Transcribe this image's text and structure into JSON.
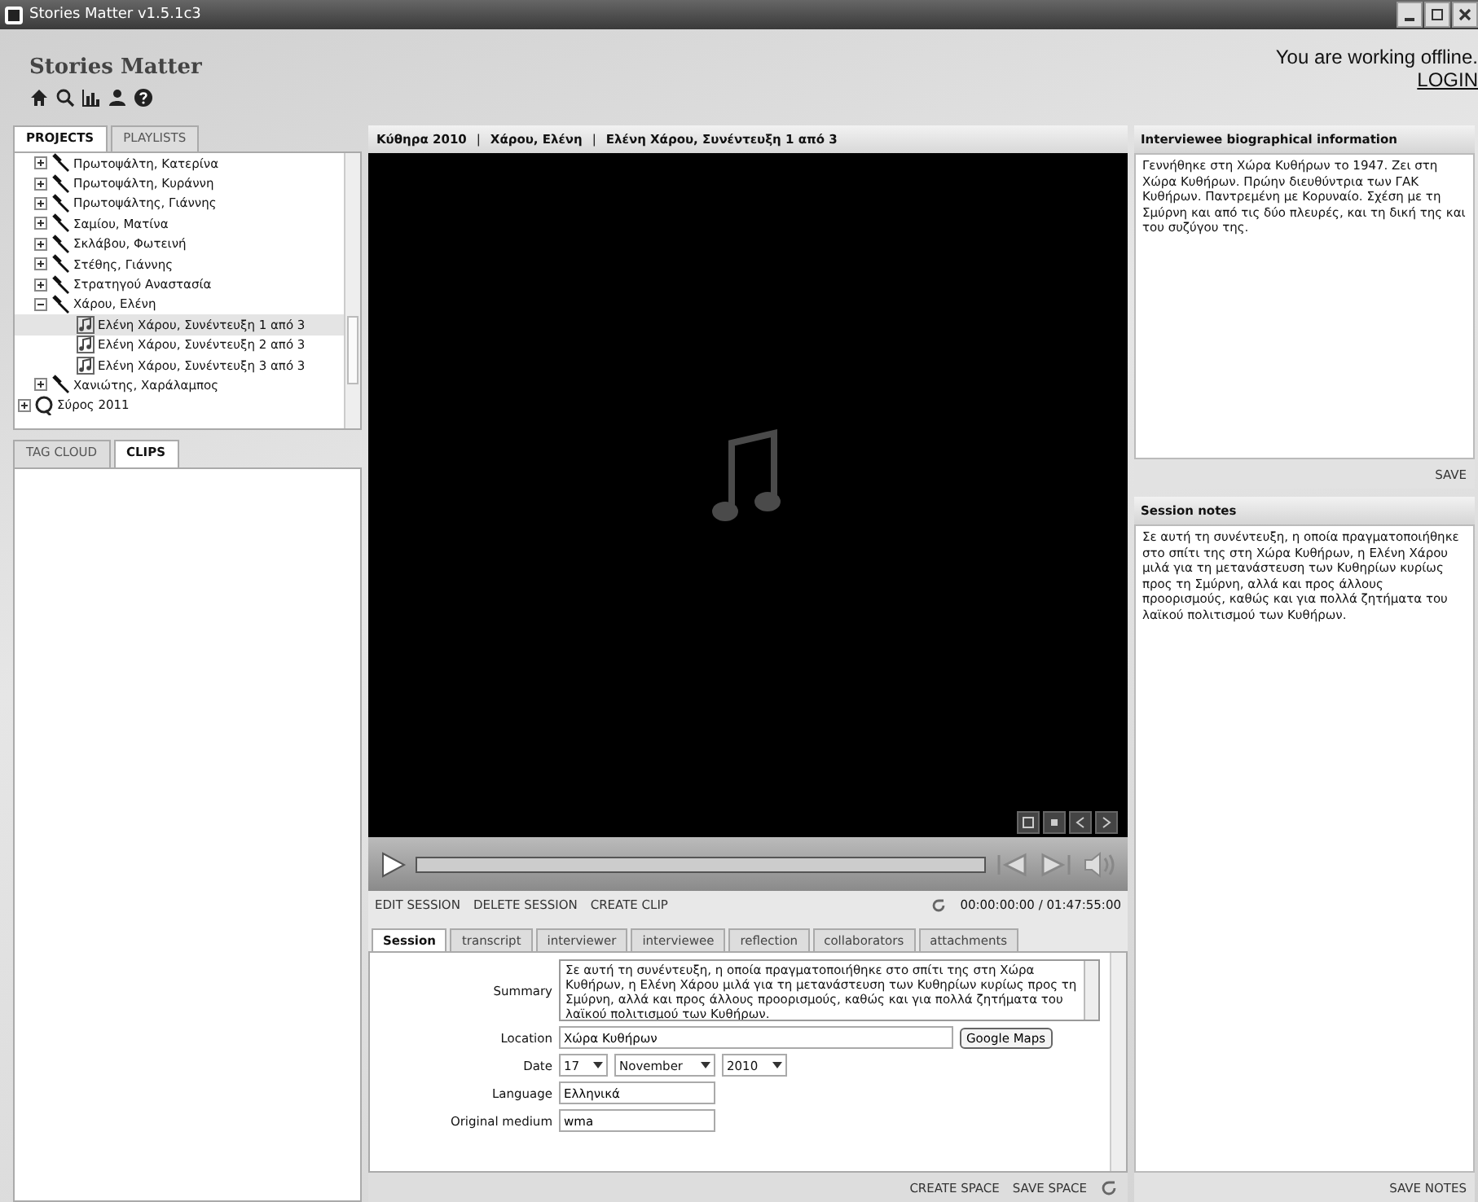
{
  "window": {
    "title": "Stories Matter v1.5.1c3"
  },
  "header": {
    "app_name": "Stories Matter",
    "status": "You are working offline.",
    "login": "LOGIN"
  },
  "left_tabs": [
    {
      "label": "PROJECTS",
      "selected": true
    },
    {
      "label": "PLAYLISTS",
      "selected": false
    }
  ],
  "tree": [
    {
      "children": [
        {
          "kind": "interviewee",
          "label": "Πρωτοψάλτη, Κατερίνα",
          "expanded": false
        },
        {
          "kind": "interviewee",
          "label": "Πρωτοψάλτη, Κυράννη",
          "expanded": false
        },
        {
          "kind": "interviewee",
          "label": "Πρωτοψάλτης, Γιάννης",
          "expanded": false
        },
        {
          "kind": "interviewee",
          "label": "Σαμίου, Ματίνα",
          "expanded": false
        },
        {
          "kind": "interviewee",
          "label": "Σκλάβου, Φωτεινή",
          "expanded": false
        },
        {
          "kind": "interviewee",
          "label": "Στέθης, Γιάννης",
          "expanded": false
        },
        {
          "kind": "interviewee",
          "label": "Στρατηγού Αναστασία",
          "expanded": false
        },
        {
          "kind": "interviewee",
          "label": "Χάρου, Ελένη",
          "expanded": true,
          "children": [
            {
              "kind": "session",
              "label": "Ελένη Χάρου, Συνέντευξη 1 από 3",
              "selected": true
            },
            {
              "kind": "session",
              "label": "Ελένη Χάρου, Συνέντευξη 2 από 3",
              "selected": false
            },
            {
              "kind": "session",
              "label": "Ελένη Χάρου, Συνέντευξη 3 από 3",
              "selected": false
            }
          ]
        },
        {
          "kind": "interviewee",
          "label": "Χανιώτης, Χαράλαμπος",
          "expanded": false
        }
      ]
    },
    {
      "kind": "project",
      "label": "Σύρος 2011",
      "expanded": false
    }
  ],
  "lower_tabs": [
    {
      "label": "TAG CLOUD",
      "selected": false
    },
    {
      "label": "CLIPS",
      "selected": true
    }
  ],
  "breadcrumb": {
    "separator": "|",
    "parts": [
      "Κύθηρα 2010",
      "Χάρου, Ελένη",
      "Ελένη Χάρου, Συνέντευξη 1 από 3"
    ]
  },
  "player": {
    "time": "00:00:00:00 / 01:47:55:00"
  },
  "session_actions": [
    "EDIT SESSION",
    "DELETE SESSION",
    "CREATE CLIP"
  ],
  "session_tabs": [
    {
      "label": "Session",
      "selected": true
    },
    {
      "label": "transcript",
      "selected": false
    },
    {
      "label": "interviewer",
      "selected": false
    },
    {
      "label": "interviewee",
      "selected": false
    },
    {
      "label": "reflection",
      "selected": false
    },
    {
      "label": "collaborators",
      "selected": false
    },
    {
      "label": "attachments",
      "selected": false
    }
  ],
  "session_form": {
    "summary_label": "Summary",
    "summary": "Σε αυτή τη συνέντευξη, η οποία πραγματοποιήθηκε στο σπίτι της στη Χώρα Κυθήρων, η Ελένη Χάρου μιλά για τη μετανάστευση των Κυθηρίων κυρίως προς τη Σμύρνη, αλλά και προς άλλους προορισμούς, καθώς και για πολλά ζητήματα του λαϊκού πολιτισμού των Κυθήρων.",
    "location_label": "Location",
    "location": "Χώρα Κυθήρων",
    "maps_button": "Google Maps",
    "date_label": "Date",
    "day": "17",
    "month": "November",
    "year": "2010",
    "language_label": "Language",
    "language": "Ελληνικά",
    "medium_label": "Original medium",
    "medium": "wma"
  },
  "space_actions": [
    "CREATE SPACE",
    "SAVE SPACE"
  ],
  "bio": {
    "title": "Interviewee biographical information",
    "text": "Γεννήθηκε στη Χώρα Κυθήρων το 1947. Ζει στη Χώρα Κυθήρων. Πρώην διευθύντρια των ΓΑΚ Κυθήρων. Παντρεμένη με Κορυναίο. Σχέση με τη Σμύρνη και από τις δύο πλευρές, και τη δική της και του συζύγου της.",
    "save": "SAVE"
  },
  "notes": {
    "title": "Session notes",
    "text": "Σε αυτή τη συνέντευξη, η οποία πραγματοποιήθηκε στο σπίτι της στη Χώρα Κυθήρων, η Ελένη Χάρου μιλά για τη μετανάστευση των Κυθηρίων κυρίως προς τη Σμύρνη, αλλά και προς άλλους προορισμούς, καθώς και για πολλά ζητήματα του λαϊκού πολιτισμού των Κυθήρων.",
    "save": "SAVE NOTES"
  }
}
